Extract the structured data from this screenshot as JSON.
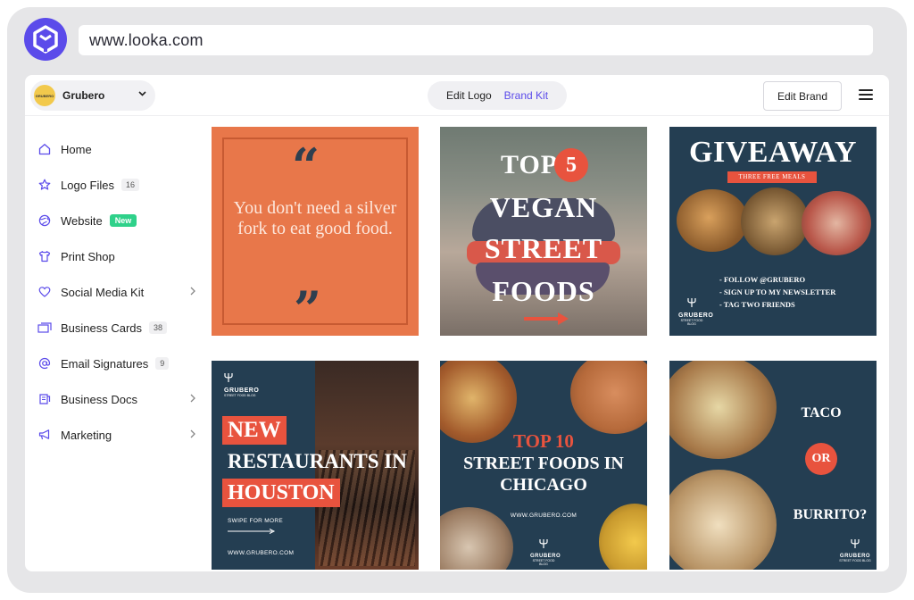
{
  "browser": {
    "url": "www.looka.com"
  },
  "topbar": {
    "brand_name": "Grubero",
    "brand_avatar_text": "GRUBERO",
    "tabs": [
      {
        "label": "Edit Logo"
      },
      {
        "label": "Brand Kit"
      }
    ],
    "edit_brand_label": "Edit Brand"
  },
  "sidebar": {
    "items": [
      {
        "label": "Home",
        "icon": "home-icon"
      },
      {
        "label": "Logo Files",
        "badge": "16",
        "icon": "star-icon"
      },
      {
        "label": "Website",
        "badge": "New",
        "icon": "globe-icon"
      },
      {
        "label": "Print Shop",
        "icon": "shirt-icon"
      },
      {
        "label": "Social Media Kit",
        "icon": "heart-icon",
        "has_submenu": true
      },
      {
        "label": "Business Cards",
        "badge": "38",
        "icon": "card-icon"
      },
      {
        "label": "Email Signatures",
        "badge": "9",
        "icon": "at-icon"
      },
      {
        "label": "Business Docs",
        "icon": "docs-icon",
        "has_submenu": true
      },
      {
        "label": "Marketing",
        "icon": "megaphone-icon",
        "has_submenu": true
      }
    ]
  },
  "cards": {
    "quote": {
      "text": "You don't need a silver fork to eat good food."
    },
    "vegan": {
      "top": "TOP",
      "number": "5",
      "line1": "VEGAN",
      "line2": "STREET",
      "line3": "FOODS"
    },
    "giveaway": {
      "title": "GIVEAWAY",
      "ribbon": "THREE FREE MEALS",
      "bullets": [
        "- FOLLOW @GRUBERO",
        "- SIGN UP TO MY NEWSLETTER",
        "- TAG TWO FRIENDS"
      ],
      "brand": "GRUBERO",
      "tagline": "STREET FOOD BLOG"
    },
    "restaurants": {
      "brand": "GRUBERO",
      "tagline": "STREET FOOD BLOG",
      "line1": "NEW",
      "line2": "RESTAURANTS IN",
      "line3": "HOUSTON",
      "swipe": "SWIPE FOR MORE",
      "url": "WWW.GRUBERO.COM"
    },
    "top10": {
      "top": "TOP 10",
      "line1": "STREET FOODS IN",
      "line2": "CHICAGO",
      "url": "WWW.GRUBERO.COM",
      "brand": "GRUBERO",
      "tagline": "STREET FOOD BLOG"
    },
    "taco": {
      "line1": "TACO",
      "or": "OR",
      "line2": "BURRITO?",
      "brand": "GRUBERO",
      "tagline": "STREET FOOD BLOG"
    }
  },
  "colors": {
    "accent": "#5b4bea",
    "coral": "#e8533e",
    "navy": "#243e52",
    "orange": "#e8774a",
    "new_badge": "#2fd18a"
  }
}
